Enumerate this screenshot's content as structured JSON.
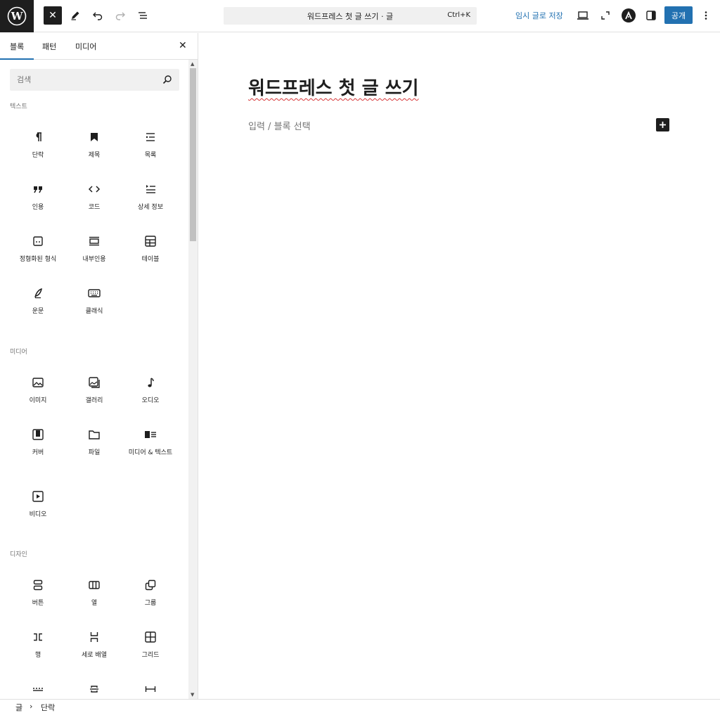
{
  "toolbar": {
    "close_label": "✕",
    "command": {
      "title": "워드프레스 첫 글 쓰기 · 글",
      "shortcut": "Ctrl+K"
    },
    "save_draft_label": "임시 글로 저장",
    "publish_label": "공개"
  },
  "sidebar": {
    "tabs": [
      {
        "label": "블록"
      },
      {
        "label": "패턴"
      },
      {
        "label": "미디어"
      }
    ],
    "close_label": "✕",
    "search_placeholder": "검색",
    "categories": [
      {
        "name": "텍스트",
        "blocks": [
          {
            "label": "단락",
            "icon": "paragraph-icon"
          },
          {
            "label": "제목",
            "icon": "heading-icon"
          },
          {
            "label": "목록",
            "icon": "list-icon"
          },
          {
            "label": "인용",
            "icon": "quote-icon"
          },
          {
            "label": "코드",
            "icon": "code-icon"
          },
          {
            "label": "상세 정보",
            "icon": "details-icon"
          },
          {
            "label": "정형화된 형식",
            "icon": "preformatted-icon"
          },
          {
            "label": "내부인용",
            "icon": "pullquote-icon"
          },
          {
            "label": "테이블",
            "icon": "table-icon"
          },
          {
            "label": "운문",
            "icon": "verse-icon"
          },
          {
            "label": "클래식",
            "icon": "keyboard-icon"
          }
        ]
      },
      {
        "name": "미디어",
        "blocks": [
          {
            "label": "이미지",
            "icon": "image-icon"
          },
          {
            "label": "갤러리",
            "icon": "gallery-icon"
          },
          {
            "label": "오디오",
            "icon": "audio-icon"
          },
          {
            "label": "커버",
            "icon": "cover-icon"
          },
          {
            "label": "파일",
            "icon": "file-icon"
          },
          {
            "label": "미디어 & 텍스트",
            "icon": "media-text-icon"
          },
          {
            "label": "비디오",
            "icon": "video-icon"
          }
        ]
      },
      {
        "name": "디자인",
        "blocks": [
          {
            "label": "버튼",
            "icon": "buttons-icon"
          },
          {
            "label": "열",
            "icon": "columns-icon"
          },
          {
            "label": "그룹",
            "icon": "group-icon"
          },
          {
            "label": "행",
            "icon": "row-icon"
          },
          {
            "label": "세로 배열",
            "icon": "stack-icon"
          },
          {
            "label": "그리드",
            "icon": "grid-icon"
          }
        ]
      }
    ]
  },
  "editor": {
    "post_title": "워드프레스 첫 글 쓰기",
    "block_placeholder": "입력 / 블록 선택"
  },
  "footer": {
    "breadcrumb": [
      "글",
      "단락"
    ],
    "separator": "›"
  },
  "colors": {
    "accent": "#2271b1",
    "dark": "#1e1e1e",
    "muted": "#757575",
    "spellcheck": "#d63638"
  }
}
